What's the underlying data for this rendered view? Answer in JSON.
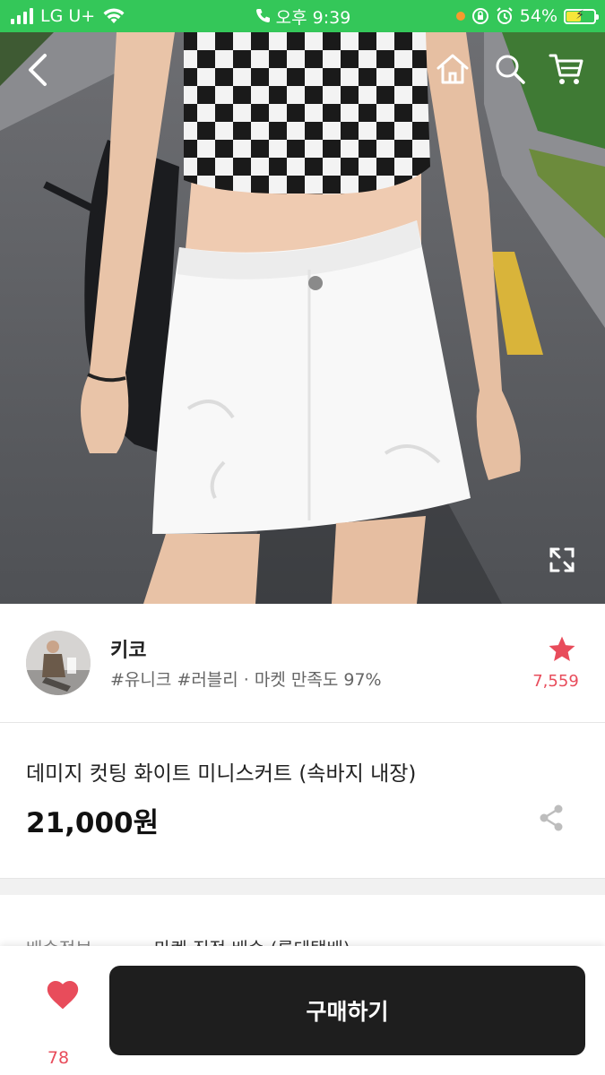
{
  "status_bar": {
    "carrier": "LG U+",
    "time": "오후 9:39",
    "battery_percent": "54%",
    "battery_level": 0.54
  },
  "nav": {
    "icons": [
      "back-arrow-icon",
      "home-icon",
      "search-icon",
      "cart-icon",
      "expand-icon"
    ]
  },
  "seller": {
    "name": "키코",
    "tags": "#유니크 #러블리 · 마켓 만족도 97%",
    "favorite_count": "7,559"
  },
  "product": {
    "title": "데미지 컷팅 화이트 미니스커트 (속바지 내장)",
    "price": "21,000원"
  },
  "shipping": {
    "label": "배송정보",
    "value": "마켓 직접 배송 (롯데택배)"
  },
  "bottom": {
    "like_count": "78",
    "buy_label": "구매하기"
  },
  "colors": {
    "status_bar": "#34c759",
    "accent_red": "#e84c5b",
    "buy_button": "#1e1e1e"
  }
}
